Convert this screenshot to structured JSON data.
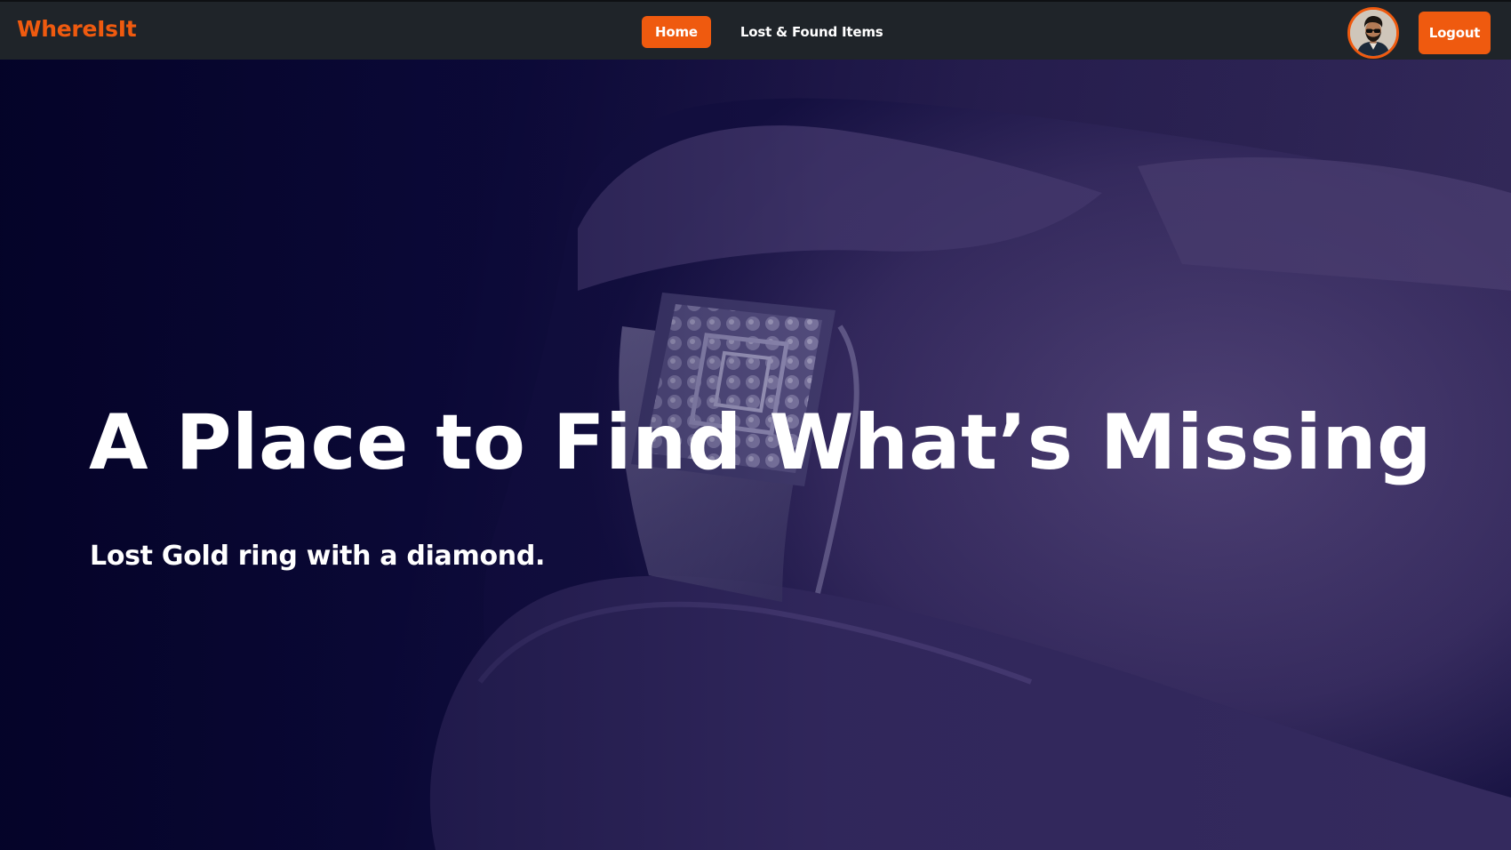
{
  "brand": {
    "name": "WhereIsIt"
  },
  "nav": {
    "items": [
      {
        "label": "Home",
        "active": true
      },
      {
        "label": "Lost & Found Items",
        "active": false
      }
    ]
  },
  "user": {
    "avatar_icon": "user-avatar"
  },
  "actions": {
    "logout_label": "Logout"
  },
  "hero": {
    "title": "A Place to Find What’s Missing",
    "subtitle": "Lost Gold ring with a diamond.",
    "image_subject": "hand-with-ring"
  },
  "colors": {
    "accent": "#ef5a0f",
    "navbar_bg": "#1f2429",
    "hero_tint": "#1a1450",
    "text": "#ffffff"
  }
}
